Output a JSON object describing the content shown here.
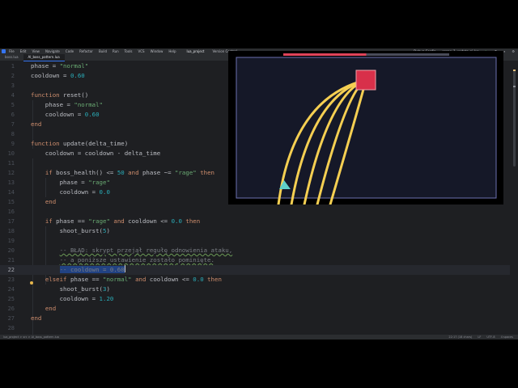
{
  "menubar": {
    "items": [
      "File",
      "Edit",
      "View",
      "Navigate",
      "Code",
      "Refactor",
      "Build",
      "Run",
      "Tools",
      "VCS",
      "Window",
      "Help"
    ],
    "project": "lua_project",
    "branch": "Version Control",
    "run_config": "Debug Config",
    "run_file": "scene_1_update_ai.lua"
  },
  "tabs": [
    {
      "label": "boss.lua"
    },
    {
      "label": "AI_boss_pattern.lua"
    }
  ],
  "editor": {
    "current_line": 22,
    "lines": [
      {
        "n": 1,
        "tokens": [
          {
            "t": "phase = "
          },
          {
            "t": "\"normal\"",
            "c": "str"
          }
        ]
      },
      {
        "n": 2,
        "tokens": [
          {
            "t": "cooldown = "
          },
          {
            "t": "0.60",
            "c": "num"
          }
        ]
      },
      {
        "n": 3,
        "tokens": []
      },
      {
        "n": 4,
        "tokens": [
          {
            "t": "function",
            "c": "kw"
          },
          {
            "t": " reset()"
          }
        ]
      },
      {
        "n": 5,
        "tokens": [
          {
            "t": "    phase = "
          },
          {
            "t": "\"normal\"",
            "c": "str"
          }
        ]
      },
      {
        "n": 6,
        "tokens": [
          {
            "t": "    cooldown = "
          },
          {
            "t": "0.60",
            "c": "num"
          }
        ]
      },
      {
        "n": 7,
        "tokens": [
          {
            "t": "end",
            "c": "kw"
          }
        ]
      },
      {
        "n": 8,
        "tokens": []
      },
      {
        "n": 9,
        "tokens": [
          {
            "t": "function",
            "c": "kw"
          },
          {
            "t": " update(delta_time)"
          }
        ]
      },
      {
        "n": 10,
        "tokens": [
          {
            "t": "    cooldown = cooldown - delta_time"
          }
        ]
      },
      {
        "n": 11,
        "tokens": []
      },
      {
        "n": 12,
        "tokens": [
          {
            "t": "    "
          },
          {
            "t": "if",
            "c": "kw"
          },
          {
            "t": " boss_health() <= "
          },
          {
            "t": "50",
            "c": "num"
          },
          {
            "t": " "
          },
          {
            "t": "and",
            "c": "kw"
          },
          {
            "t": " phase ~= "
          },
          {
            "t": "\"rage\"",
            "c": "str"
          },
          {
            "t": " "
          },
          {
            "t": "then",
            "c": "kw"
          }
        ]
      },
      {
        "n": 13,
        "tokens": [
          {
            "t": "        phase = "
          },
          {
            "t": "\"rage\"",
            "c": "str"
          }
        ]
      },
      {
        "n": 14,
        "tokens": [
          {
            "t": "        cooldown = "
          },
          {
            "t": "0.0",
            "c": "num"
          }
        ]
      },
      {
        "n": 15,
        "tokens": [
          {
            "t": "    "
          },
          {
            "t": "end",
            "c": "kw"
          }
        ]
      },
      {
        "n": 16,
        "tokens": []
      },
      {
        "n": 17,
        "tokens": [
          {
            "t": "    "
          },
          {
            "t": "if",
            "c": "kw"
          },
          {
            "t": " phase == "
          },
          {
            "t": "\"rage\"",
            "c": "str"
          },
          {
            "t": " "
          },
          {
            "t": "and",
            "c": "kw"
          },
          {
            "t": " cooldown <= "
          },
          {
            "t": "0.0",
            "c": "num"
          },
          {
            "t": " "
          },
          {
            "t": "then",
            "c": "kw"
          }
        ]
      },
      {
        "n": 18,
        "tokens": [
          {
            "t": "        shoot_burst("
          },
          {
            "t": "5",
            "c": "num"
          },
          {
            "t": ")"
          }
        ]
      },
      {
        "n": 19,
        "tokens": []
      },
      {
        "n": 20,
        "tokens": [
          {
            "t": "        "
          },
          {
            "t": "-- BŁĄD: skrypt przejął regułę odnowienia ataku,",
            "c": "cm err"
          }
        ]
      },
      {
        "n": 21,
        "tokens": [
          {
            "t": "        "
          },
          {
            "t": "-- a poniższe ustawienie zostało pominięte.",
            "c": "cm err"
          }
        ]
      },
      {
        "n": 22,
        "tokens": [
          {
            "t": "        "
          },
          {
            "t": "-- cooldown = 0.60",
            "c": "cm sel"
          },
          {
            "t": "",
            "c": "caret"
          }
        ]
      },
      {
        "n": 23,
        "tokens": [
          {
            "t": "    "
          },
          {
            "t": "elseif",
            "c": "kw"
          },
          {
            "t": " phase == "
          },
          {
            "t": "\"normal\"",
            "c": "str"
          },
          {
            "t": " "
          },
          {
            "t": "and",
            "c": "kw"
          },
          {
            "t": " cooldown <= "
          },
          {
            "t": "0.0",
            "c": "num"
          },
          {
            "t": " "
          },
          {
            "t": "then",
            "c": "kw"
          }
        ]
      },
      {
        "n": 24,
        "tokens": [
          {
            "t": "        shoot_burst("
          },
          {
            "t": "3",
            "c": "num"
          },
          {
            "t": ")"
          }
        ]
      },
      {
        "n": 25,
        "tokens": [
          {
            "t": "        cooldown = "
          },
          {
            "t": "1.20",
            "c": "num"
          }
        ]
      },
      {
        "n": 26,
        "tokens": [
          {
            "t": "    "
          },
          {
            "t": "end",
            "c": "kw"
          }
        ]
      },
      {
        "n": 27,
        "tokens": [
          {
            "t": "end",
            "c": "kw"
          }
        ]
      },
      {
        "n": 28,
        "tokens": []
      }
    ]
  },
  "game": {
    "boss_health": 0.5,
    "health_fill_color": "#e0445a",
    "health_track_color": "#4a4c5a",
    "arena_bg": "#151828",
    "arena_border": "#6b6fb0",
    "boss_color": "#d8304a",
    "bullet_color": "#f5cf52",
    "player_color": "#5fd0c8",
    "projectile_count": 5
  },
  "statusbar": {
    "breadcrumb": "lua_project > src > AI_boss_pattern.lua",
    "position": "22:17 (18 chars)",
    "line_sep": "LF",
    "encoding": "UTF-8",
    "indent": "4 spaces"
  }
}
